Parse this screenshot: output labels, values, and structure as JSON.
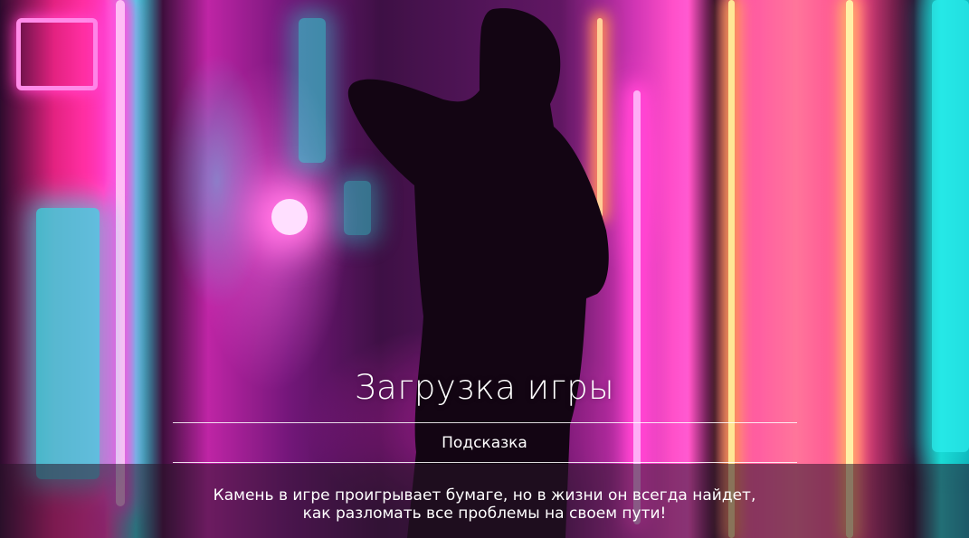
{
  "loading_screen": {
    "title": "Загрузка игры",
    "hint_label": "Подсказка",
    "hint_lines": [
      "Камень в игре проигрывает бумаге, но в жизни он всегда найдет,",
      "как разломать все проблемы на своем пути!"
    ]
  },
  "background": {
    "icon": "neon-alley-silhouette-image",
    "accent_colors": [
      "#ff3fb0",
      "#40e0e0",
      "#ffd080"
    ]
  }
}
